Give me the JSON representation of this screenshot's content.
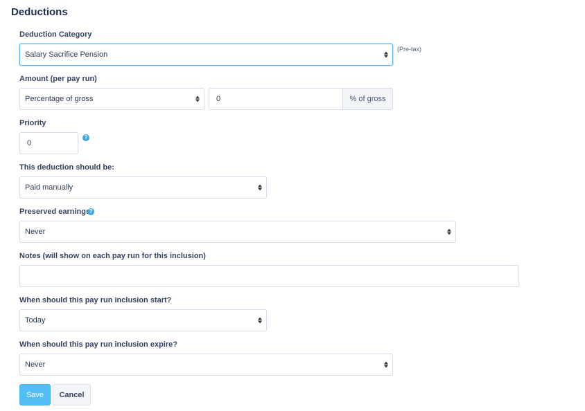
{
  "page": {
    "title": "Deductions"
  },
  "category": {
    "label": "Deduction Category",
    "value": "Salary Sacrifice Pension",
    "note": "(Pre-tax)"
  },
  "amount": {
    "label": "Amount (per pay run)",
    "type_value": "Percentage of gross",
    "value": "0",
    "addon": "% of gross"
  },
  "priority": {
    "label": "Priority",
    "value": "0",
    "help_glyph": "?"
  },
  "paid_as": {
    "label": "This deduction should be:",
    "value": "Paid manually"
  },
  "preserved": {
    "label": "Preserved earnings",
    "value": "Never",
    "help_glyph": "?"
  },
  "notes": {
    "label": "Notes (will show on each pay run for this inclusion)",
    "value": ""
  },
  "start": {
    "label": "When should this pay run inclusion start?",
    "value": "Today"
  },
  "expire": {
    "label": "When should this pay run inclusion expire?",
    "value": "Never"
  },
  "actions": {
    "save": "Save",
    "cancel": "Cancel"
  },
  "colors": {
    "accent": "#52bef5",
    "help": "#3aa6e4",
    "focus": "#5fb6ea"
  }
}
